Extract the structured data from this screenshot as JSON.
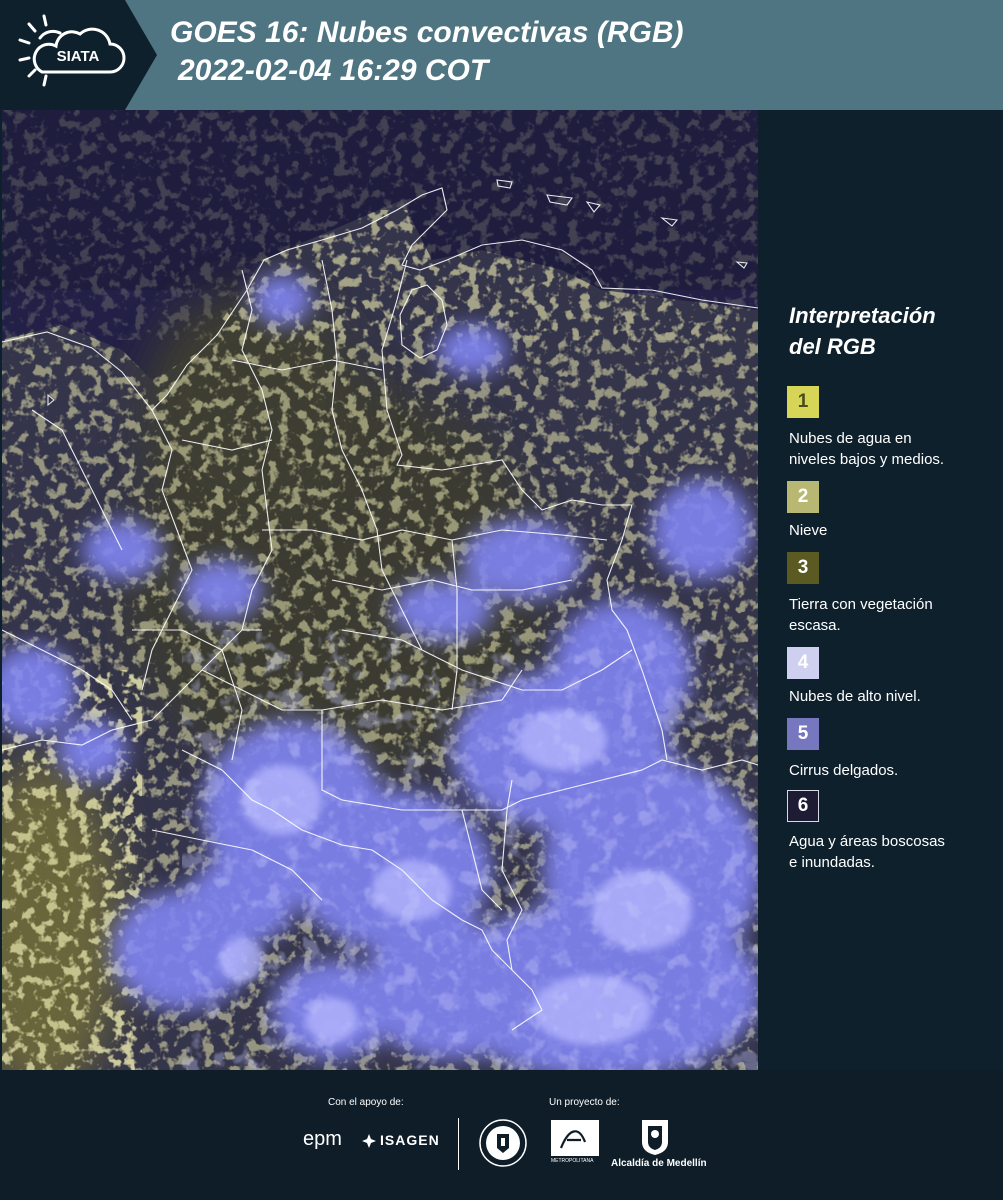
{
  "header": {
    "logo_text": "SIATA",
    "title_line1": "GOES 16: Nubes convectivas (RGB)",
    "title_line2": "2022-02-04 16:29 COT"
  },
  "legend": {
    "title_line1": "Interpretación",
    "title_line2": "del RGB",
    "items": [
      {
        "number": "1",
        "color": "#d6d557",
        "label_line1": "Nubes de agua en",
        "label_line2": "niveles bajos y medios."
      },
      {
        "number": "2",
        "color": "#b9b872",
        "label_line1": "Nieve",
        "label_line2": ""
      },
      {
        "number": "3",
        "color": "#5a5a22",
        "label_line1": "Tierra con vegetación",
        "label_line2": "escasa."
      },
      {
        "number": "4",
        "color": "#cfcff0",
        "label_line1": "Nubes de alto nivel.",
        "label_line2": ""
      },
      {
        "number": "5",
        "color": "#7777bf",
        "label_line1": "Cirrus delgados.",
        "label_line2": ""
      },
      {
        "number": "6",
        "color": "#1e1c35",
        "label_line1": "Agua y áreas boscosas",
        "label_line2": "e inundadas."
      }
    ]
  },
  "footer": {
    "support_label": "Con el apoyo de:",
    "project_label": "Un proyecto de:",
    "epm_text": "epm",
    "isagen_text": "ISAGEN",
    "area_text": "METROPOLITANA",
    "alcaldia_text": "Alcaldía de Medellín"
  },
  "colors": {
    "header_bg": "#4f7582",
    "logo_bg": "#0f202d",
    "page_bg": "#0f202d",
    "ocean": "#222046",
    "cloud_high": "#8b8ef5",
    "cloud_low": "#c9c46a"
  }
}
